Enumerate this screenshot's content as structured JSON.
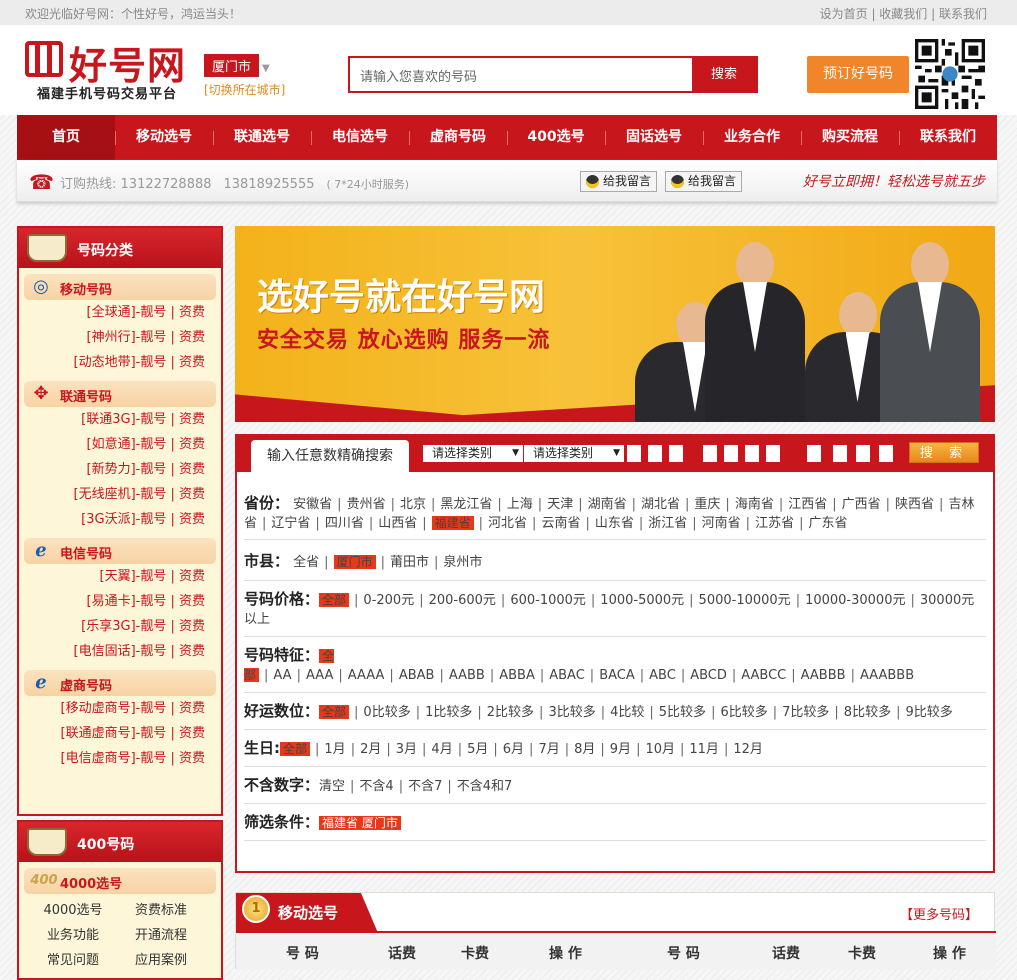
{
  "topbar": {
    "welcome": "欢迎光临好号网：个性好号，鸿运当头！",
    "links": [
      "设为首页",
      "收藏我们",
      "联系我们"
    ]
  },
  "header": {
    "logo_name": "好号网",
    "logo_sub": "福建手机号码交易平台",
    "city": "厦门市",
    "city_change": "[切换所在城市]",
    "search_placeholder": "请输入您喜欢的号码",
    "search_btn": "搜索",
    "book_btn": "预订好号码"
  },
  "nav": [
    "首页",
    "移动选号",
    "联通选号",
    "电信选号",
    "虚商号码",
    "400选号",
    "固话选号",
    "业务合作",
    "购买流程",
    "联系我们"
  ],
  "hotline": {
    "label": "订购热线:",
    "phone1": "13122728888",
    "phone2": "13818925555",
    "hours": "( 7*24小时服务)",
    "qq1": "给我留言",
    "qq2": "给我留言",
    "slogan": "好号立即拥！轻松选号就五步"
  },
  "sidebar": {
    "title": "号码分类",
    "groups": [
      {
        "name": "移动号码",
        "items": [
          "[全球通]-靓号 | 资费",
          "[神州行]-靓号 | 资费",
          "[动态地带]-靓号 | 资费"
        ]
      },
      {
        "name": "联通号码",
        "items": [
          "[联通3G]-靓号 | 资费",
          "[如意通]-靓号 | 资费",
          "[新势力]-靓号 | 资费",
          "[无线座机]-靓号 | 资费",
          "[3G沃派]-靓号 | 资费"
        ]
      },
      {
        "name": "电信号码",
        "items": [
          "[天翼]-靓号 | 资费",
          "[易通卡]-靓号 | 资费",
          "[乐享3G]-靓号 | 资费",
          "[电信固话]-靓号 | 资费"
        ]
      },
      {
        "name": "虚商号码",
        "items": [
          "[移动虚商号]-靓号 | 资费",
          "[联通虚商号]-靓号 | 资费",
          "[电信虚商号]-靓号 | 资费"
        ]
      }
    ],
    "box2_title": "400号码",
    "box2_cat": "4000选号",
    "box2_icon": "400",
    "box2_items": [
      "4000选号",
      "资费标准",
      "业务功能",
      "开通流程",
      "常见问题",
      "应用案例"
    ]
  },
  "banner": {
    "t1": "选好号就在好号网",
    "t2": "安全交易 放心选购 服务一流"
  },
  "filter": {
    "tab": "输入任意数精确搜索",
    "select1": "请选择类别",
    "select2": "请选择类别",
    "go": "搜 索",
    "province_label": "省份：",
    "provinces": [
      "安徽省",
      "贵州省",
      "北京",
      "黑龙江省",
      "上海",
      "天津",
      "湖南省",
      "湖北省",
      "重庆",
      "海南省",
      "江西省",
      "广西省",
      "陕西省",
      "吉林省",
      "辽宁省",
      "四川省",
      "山西省",
      "福建省",
      "河北省",
      "云南省",
      "山东省",
      "浙江省",
      "河南省",
      "江苏省",
      "广东省"
    ],
    "city_label": "市县：",
    "cities": [
      "全省",
      "厦门市",
      "莆田市",
      "泉州市"
    ],
    "price_label": "号码价格：",
    "prices": [
      "全部",
      "0-200元",
      "200-600元",
      "600-1000元",
      "1000-5000元",
      "5000-10000元",
      "10000-30000元",
      "30000元以上"
    ],
    "feature_label": "号码特征：",
    "features": [
      "全部",
      "AA",
      "AAA",
      "AAAA",
      "ABAB",
      "AABB",
      "ABBA",
      "ABAC",
      "BACA",
      "ABC",
      "ABCD",
      "AABCC",
      "AABBB",
      "AAABBB"
    ],
    "lucky_label": "好运数位：",
    "lucky": [
      "全部",
      "0比较多",
      "1比较多",
      "2比较多",
      "3比较多",
      "4比较",
      "5比较多",
      "6比较多",
      "7比较多",
      "8比较多",
      "9比较多"
    ],
    "birth_label": "生日:",
    "births": [
      "全部",
      "1月",
      "2月",
      "3月",
      "4月",
      "5月",
      "6月",
      "7月",
      "8月",
      "9月",
      "10月",
      "11月",
      "12月"
    ],
    "exclude_label": "不含数字：",
    "excludes": [
      "清空",
      "不含4",
      "不含7",
      "不含4和7"
    ],
    "cond_label": "筛选条件：",
    "cond": "福建省 厦门市"
  },
  "list": {
    "title": "移动选号",
    "medal": "1",
    "more": "【更多号码】",
    "cols": [
      "号 码",
      "话费",
      "卡费",
      "操 作",
      "号 码",
      "话费",
      "卡费",
      "操 作"
    ]
  }
}
